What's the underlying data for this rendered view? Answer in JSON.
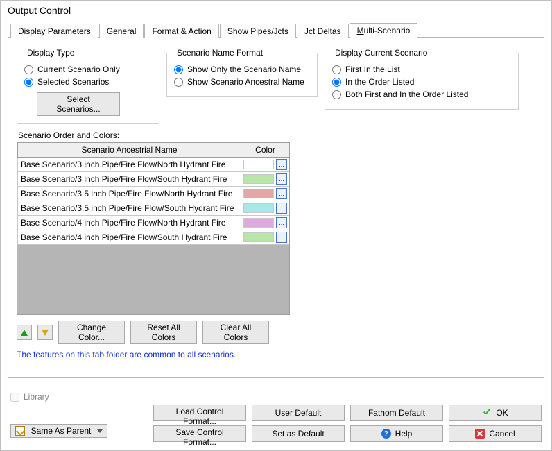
{
  "title": "Output Control",
  "tabs": [
    {
      "label_pre": "Display ",
      "ul": "P",
      "label_post": "arameters"
    },
    {
      "label_pre": "",
      "ul": "G",
      "label_post": "eneral"
    },
    {
      "label_pre": "",
      "ul": "F",
      "label_post": "ormat & Action"
    },
    {
      "label_pre": "",
      "ul": "S",
      "label_post": "how Pipes/Jcts"
    },
    {
      "label_pre": "Jct ",
      "ul": "D",
      "label_post": "eltas"
    },
    {
      "label_pre": "",
      "ul": "M",
      "label_post": "ulti-Scenario"
    }
  ],
  "active_tab": 5,
  "group_display_type": {
    "legend": "Display Type",
    "opt_current": "Current Scenario Only",
    "opt_selected": "Selected Scenarios",
    "btn_select": "Select Scenarios...",
    "selected": "selected"
  },
  "group_name_format": {
    "legend": "Scenario Name Format",
    "opt_only": "Show Only the Scenario Name",
    "opt_ancestral": "Show Scenario Ancestral Name",
    "selected": "only"
  },
  "group_current_scenario": {
    "legend": "Display Current Scenario",
    "opt_first": "First In the List",
    "opt_order": "In the Order Listed",
    "opt_both": "Both First and In the Order Listed",
    "selected": "order"
  },
  "grid": {
    "label": "Scenario Order and Colors:",
    "col_name": "Scenario Ancestrial Name",
    "col_color": "Color",
    "rows": [
      {
        "name": "Base Scenario/3 inch Pipe/Fire Flow/North Hydrant Fire",
        "color": "#ffffff"
      },
      {
        "name": "Base Scenario/3 inch Pipe/Fire Flow/South Hydrant Fire",
        "color": "#b7e6a8"
      },
      {
        "name": "Base Scenario/3.5 inch Pipe/Fire Flow/North Hydrant Fire",
        "color": "#e2a8a8"
      },
      {
        "name": "Base Scenario/3.5 inch Pipe/Fire Flow/South Hydrant Fire",
        "color": "#a8e8e8"
      },
      {
        "name": "Base Scenario/4 inch Pipe/Fire Flow/North Hydrant Fire",
        "color": "#dfa8df"
      },
      {
        "name": "Base Scenario/4 inch Pipe/Fire Flow/South Hydrant Fire",
        "color": "#b7e6a8"
      }
    ]
  },
  "buttons": {
    "change_color": "Change Color...",
    "reset_colors": "Reset All Colors",
    "clear_colors": "Clear All Colors"
  },
  "note": "The features on this tab folder are common to all scenarios.",
  "footer": {
    "library": "Library",
    "parent_combo": "Same As Parent",
    "load": "Load Control Format...",
    "save": "Save Control Format...",
    "user_default": "User Default",
    "set_default": "Set as Default",
    "fathom_default": "Fathom Default",
    "help": "Help",
    "ok": "OK",
    "cancel": "Cancel"
  }
}
